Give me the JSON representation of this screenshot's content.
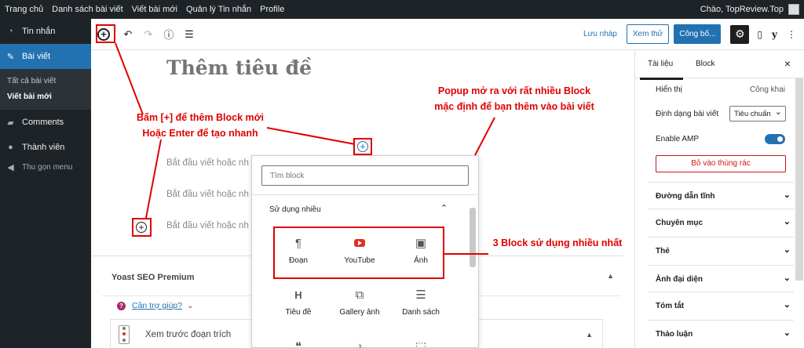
{
  "adminbar": {
    "items": [
      "Trang chủ",
      "Danh sách bài viết",
      "Viết bài mới",
      "Quản lý Tin nhắn",
      "Profile"
    ],
    "greeting": "Chào, TopReview.Top"
  },
  "sidebar": {
    "items": [
      {
        "label": "Tin nhắn",
        "icon": "gauge-icon"
      },
      {
        "label": "Bài viết",
        "icon": "pin-icon"
      },
      {
        "label": "Comments",
        "icon": "comment-icon"
      },
      {
        "label": "Thành viên",
        "icon": "user-icon"
      }
    ],
    "submenu": [
      "Tất cả bài viết",
      "Viết bài mới"
    ],
    "collapse": "Thu gọn menu"
  },
  "toolbar": {
    "save_draft": "Lưu nháp",
    "preview": "Xem thử",
    "publish": "Công bố..."
  },
  "editor": {
    "title_placeholder": "Thêm tiêu đề",
    "paragraph_placeholder": "Bắt đầu viết hoặc nh"
  },
  "inserter": {
    "search_placeholder": "Tìm block",
    "category": "Sử dụng nhiều",
    "blocks": [
      {
        "label": "Đoạn",
        "icon": "paragraph-icon"
      },
      {
        "label": "YouTube",
        "icon": "youtube-icon"
      },
      {
        "label": "Ảnh",
        "icon": "image-icon"
      },
      {
        "label": "Tiêu đề",
        "icon": "heading-icon"
      },
      {
        "label": "Gallery ảnh",
        "icon": "gallery-icon"
      },
      {
        "label": "Danh sách",
        "icon": "list-icon"
      }
    ]
  },
  "yoast": {
    "title": "Yoast SEO Premium",
    "help": "Cần trợ giúp?",
    "snippet": "Xem trước đoạn trích"
  },
  "settings": {
    "tabs": [
      "Tài liệu",
      "Block"
    ],
    "visibility_label": "Hiển thị",
    "visibility_value": "Công khai",
    "format_label": "Định dạng bài viết",
    "format_value": "Tiêu chuẩn",
    "amp_label": "Enable AMP",
    "amp_enabled": true,
    "trash": "Bỏ vào thùng rác",
    "panels": [
      "Đường dẫn tĩnh",
      "Chuyên mục",
      "Thẻ",
      "Ảnh đại diện",
      "Tóm tắt",
      "Thảo luận"
    ]
  },
  "annotations": {
    "add_block_line1": "Bấm [+] để thêm Block mới",
    "add_block_line2": "Hoặc Enter để tạo nhanh",
    "popup_line1": "Popup mở ra với rất nhiều Block",
    "popup_line2": "mặc định để bạn thêm vào bài viết",
    "most_used": "3 Block sử dụng nhiều nhất"
  }
}
